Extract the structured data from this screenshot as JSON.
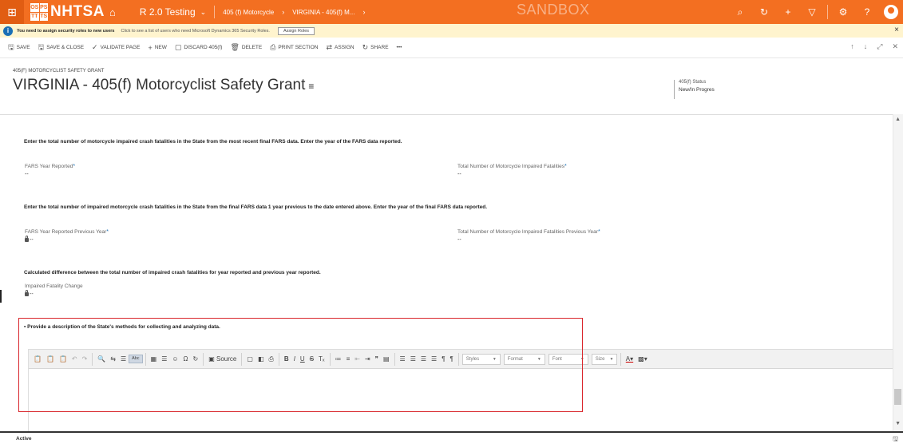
{
  "topnav": {
    "logo_mark": [
      "OS",
      "PS",
      "TT",
      "TS"
    ],
    "logo_text": "NHTSA",
    "app_title": "R 2.0 Testing",
    "breadcrumbs": [
      "405 (f) Motorcycle",
      "VIRGINIA - 405(f) M..."
    ],
    "sandbox_label": "SANDBOX",
    "icons": [
      "search-icon",
      "history-icon",
      "add-icon",
      "filter-icon",
      "settings-icon",
      "help-icon",
      "user-avatar"
    ]
  },
  "notification": {
    "main": "You need to assign security roles to new users",
    "sub": "Click to see a list of users who need Microsoft Dynamics 365 Security Roles.",
    "button": "Assign Roles",
    "close": "×"
  },
  "commandbar": {
    "items": [
      {
        "icon": "🖫",
        "label": "SAVE"
      },
      {
        "icon": "🖫",
        "label": "SAVE & CLOSE"
      },
      {
        "icon": "✓",
        "label": "VALIDATE PAGE"
      },
      {
        "icon": "+",
        "label": "NEW"
      },
      {
        "icon": "▢",
        "label": "DISCARD 405(f)"
      },
      {
        "icon": "🗑",
        "label": "DELETE"
      },
      {
        "icon": "⎙",
        "label": "PRINT SECTION"
      },
      {
        "icon": "⇄",
        "label": "ASSIGN"
      },
      {
        "icon": "↻",
        "label": "SHARE"
      },
      {
        "icon": "",
        "label": "•••"
      }
    ],
    "right_icons": [
      "↑",
      "↓",
      "⤢",
      "✕"
    ]
  },
  "header": {
    "record_type": "405(F) MOTORCYCLIST SAFETY GRANT",
    "title": "VIRGINIA - 405(f) Motorcyclist Safety Grant",
    "title_menu": "≡",
    "status_label": "405(f) Status",
    "status_value": "New/In Progres"
  },
  "form": {
    "section1": {
      "instruction": "Enter the total number of motorcycle impaired crash fatalities in the State from the most recent final FARS data. Enter the year of the FARS data reported.",
      "field_left_label": "FARS Year Reported",
      "field_left_value": "--",
      "field_right_label": "Total Number of Motorcycle Impaired Fatalities",
      "field_right_value": "--"
    },
    "section2": {
      "instruction": "Enter the total number of impaired motorcycle crash fatalities in the State from the final FARS data 1 year previous to the date entered above. Enter the year of the final FARS data reported.",
      "field_left_label": "FARS Year Reported Previous Year",
      "field_left_value": "--",
      "field_right_label": "Total Number of Motorcycle Impaired Fatalities Previous Year",
      "field_right_value": "--"
    },
    "section3": {
      "instruction": "Calculated difference between the total number of impaired crash fatalities for year reported and previous year reported.",
      "field_label": "Impaired Fatality Change",
      "field_value": "--"
    },
    "required_mark": "*",
    "section4": {
      "instruction": "Provide a description of the State's methods for collecting and analyzing data."
    }
  },
  "editor": {
    "source_label": "Source",
    "styles_label": "Styles",
    "format_label": "Format",
    "font_label": "Font",
    "size_label": "Size",
    "bold": "B",
    "italic": "I",
    "underline": "U",
    "strike": "S"
  },
  "status": {
    "text": "Active"
  }
}
